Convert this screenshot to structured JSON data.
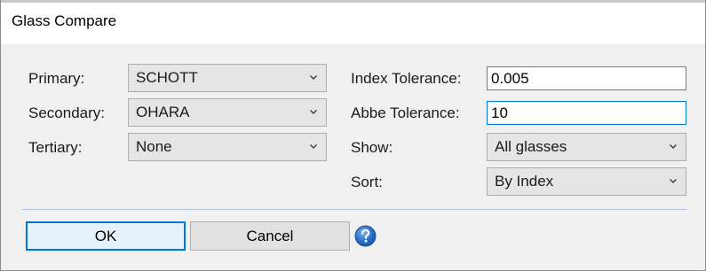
{
  "window": {
    "title": "Glass Compare"
  },
  "left": {
    "primary": {
      "label": "Primary:",
      "value": "SCHOTT"
    },
    "secondary": {
      "label": "Secondary:",
      "value": "OHARA"
    },
    "tertiary": {
      "label": "Tertiary:",
      "value": "None"
    }
  },
  "right": {
    "index_tolerance": {
      "label": "Index Tolerance:",
      "value": "0.005"
    },
    "abbe_tolerance": {
      "label": "Abbe Tolerance:",
      "value": "10"
    },
    "show": {
      "label": "Show:",
      "value": "All glasses"
    },
    "sort": {
      "label": "Sort:",
      "value": "By Index"
    }
  },
  "buttons": {
    "ok": "OK",
    "cancel": "Cancel"
  },
  "icons": {
    "help": "help-icon",
    "dropdown": "chevron-down-icon"
  },
  "colors": {
    "accent": "#0078d7",
    "help_blue": "#2a6fc9"
  }
}
